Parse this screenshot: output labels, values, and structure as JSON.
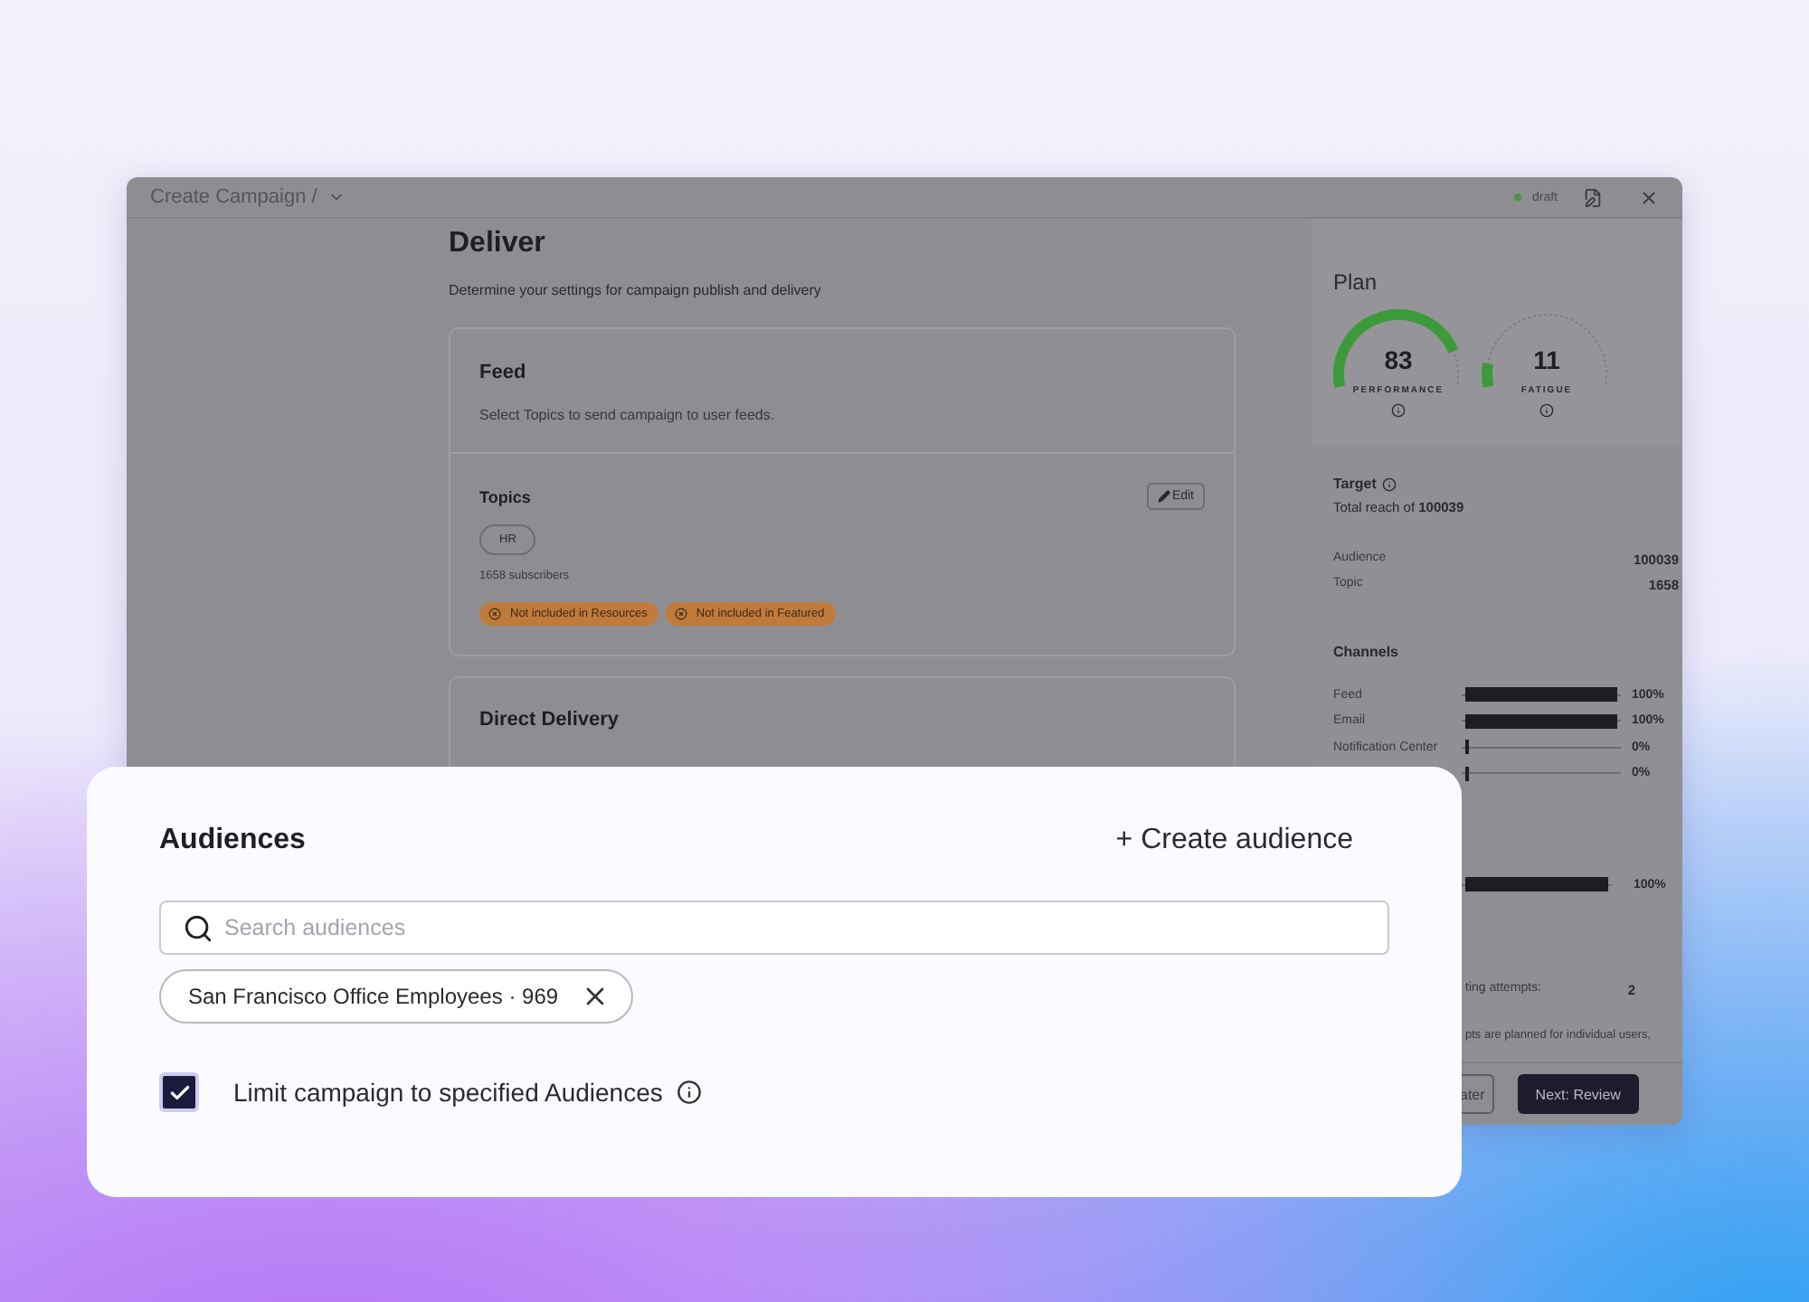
{
  "window": {
    "breadcrumb": "Create Campaign /",
    "status": {
      "label": "draft",
      "color": "#3f9a3f"
    }
  },
  "page": {
    "title": "Deliver",
    "subtitle": "Determine your settings for campaign publish and delivery"
  },
  "feed": {
    "title": "Feed",
    "description": "Select Topics to send campaign to user feeds.",
    "topics_title": "Topics",
    "edit_button": "Edit",
    "chips": [
      "HR"
    ],
    "subscribers": "1658 subscribers",
    "tags": [
      "Not included in Resources",
      "Not included in Featured"
    ]
  },
  "direct_delivery": {
    "title": "Direct Delivery"
  },
  "plan": {
    "title": "Plan",
    "gauges": [
      {
        "value": "83",
        "label": "PERFORMANCE"
      },
      {
        "value": "11",
        "label": "FATIGUE"
      }
    ]
  },
  "target": {
    "title": "Target",
    "reach": "Total reach of **100039**",
    "rows": [
      {
        "label": "Audience",
        "value": "100039"
      },
      {
        "label": "Topic",
        "value": "1658"
      }
    ]
  },
  "channels": {
    "title": "Channels",
    "rows": [
      {
        "label": "Feed",
        "level": 1,
        "reading": "100%"
      },
      {
        "label": "Email",
        "level": 1,
        "reading": "100%"
      },
      {
        "label": "Notification Center",
        "level": 0,
        "reading": "0%"
      },
      {
        "level": 0,
        "reading": "0%"
      }
    ]
  },
  "section_2": {
    "rows": [
      {
        "level": 1,
        "reading": "100%"
      }
    ]
  },
  "attempts": {
    "label": "ting attempts:",
    "value": "2",
    "note": "pts are planned for individual users,"
  },
  "footer": {
    "buttons": [
      {
        "label": "ater",
        "kind": "secondary"
      },
      {
        "label": "Next: Review",
        "kind": "primary"
      }
    ]
  },
  "audiences": {
    "title": "Audiences",
    "create_button": "+ Create audience",
    "search": {
      "placeholder": "Search audiences"
    },
    "chips": [
      {
        "label": "San Francisco Office Employees · 969"
      }
    ],
    "limit": {
      "label": "Limit campaign to specified Audiences",
      "checked": true
    }
  }
}
